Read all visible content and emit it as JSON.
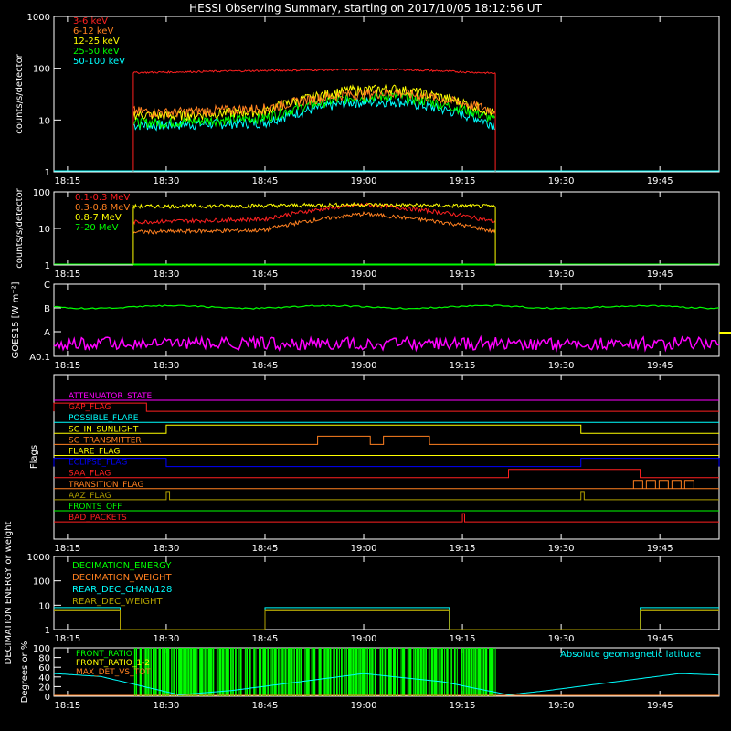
{
  "title": "HESSI Observing Summary, starting on 2017/10/05 18:12:56 UT",
  "time_ticks": [
    "18:15",
    "18:30",
    "18:45",
    "19:00",
    "19:15",
    "19:30",
    "19:45"
  ],
  "colors": {
    "background": "#000000",
    "axes": "#ffffff",
    "red": "#ff2020",
    "orange": "#ff8020",
    "yellow": "#ffff00",
    "green": "#00ff00",
    "cyan": "#00ffff",
    "blue": "#0000ff",
    "magenta": "#ff00ff",
    "olive": "#b0a000"
  },
  "chart_data": [
    {
      "type": "line",
      "ylabel": "counts/s/detector",
      "yscale": "log",
      "ylim": [
        1,
        1000
      ],
      "yticks": [
        "1",
        "10",
        "100",
        "1000"
      ],
      "xlim": [
        "18:12:56",
        "19:54"
      ],
      "data_window": [
        "18:25",
        "19:20"
      ],
      "series": [
        {
          "name": "3-6 keV",
          "color": "#ff2020",
          "x": [
            "18:25",
            "18:40",
            "18:55",
            "19:05",
            "19:20"
          ],
          "values": [
            82,
            88,
            93,
            95,
            80
          ]
        },
        {
          "name": "6-12 keV",
          "color": "#ff8020",
          "x": [
            "18:25",
            "18:30",
            "18:45",
            "18:58",
            "19:05",
            "19:20"
          ],
          "values": [
            15,
            14,
            17,
            32,
            34,
            15
          ]
        },
        {
          "name": "12-25 keV",
          "color": "#ffff00",
          "x": [
            "18:25",
            "18:30",
            "18:45",
            "18:58",
            "19:05",
            "19:20"
          ],
          "values": [
            13,
            12,
            15,
            38,
            40,
            13
          ]
        },
        {
          "name": "25-50 keV",
          "color": "#00ff00",
          "x": [
            "18:25",
            "18:30",
            "18:45",
            "18:58",
            "19:05",
            "19:20"
          ],
          "values": [
            9,
            9,
            11,
            27,
            29,
            10
          ]
        },
        {
          "name": "50-100 keV",
          "color": "#00ffff",
          "x": [
            "18:25",
            "18:30",
            "18:45",
            "18:58",
            "19:05",
            "19:20"
          ],
          "values": [
            8,
            8,
            9,
            22,
            23,
            8
          ]
        }
      ]
    },
    {
      "type": "line",
      "ylabel": "counts/s/detector",
      "yscale": "log",
      "ylim": [
        1,
        100
      ],
      "yticks": [
        "1",
        "10",
        "100"
      ],
      "series": [
        {
          "name": "0.1-0.3 MeV",
          "color": "#ff2020",
          "x": [
            "18:25",
            "18:45",
            "19:00",
            "19:20"
          ],
          "values": [
            15,
            18,
            45,
            15
          ]
        },
        {
          "name": "0.3-0.8 MeV",
          "color": "#ff8020",
          "x": [
            "18:25",
            "18:45",
            "19:00",
            "19:20"
          ],
          "values": [
            8,
            9,
            25,
            8
          ]
        },
        {
          "name": "0.8-7 MeV",
          "color": "#ffff00",
          "x": [
            "18:25",
            "18:45",
            "19:00",
            "19:20"
          ],
          "values": [
            40,
            42,
            45,
            40
          ]
        },
        {
          "name": "7-20 MeV",
          "color": "#00ff00",
          "x": [
            "18:25",
            "19:20"
          ],
          "values": [
            1,
            1
          ]
        }
      ]
    },
    {
      "type": "line",
      "ylabel": "GOES15 [W m⁻²]",
      "yticks": [
        "A0.1",
        "A",
        "B",
        "C"
      ],
      "series": [
        {
          "name": "GOES long",
          "color": "#00ff00",
          "level": "B"
        },
        {
          "name": "GOES short",
          "color": "#ff00ff",
          "level": "A0.1-A"
        }
      ]
    },
    {
      "type": "table",
      "ylabel": "Flags",
      "flags": [
        {
          "name": "ATTENUATOR_STATE",
          "color": "#ff00ff",
          "high": []
        },
        {
          "name": "GAP_FLAG",
          "color": "#ff2020",
          "high": [
            [
              "18:12:56",
              "18:27"
            ]
          ]
        },
        {
          "name": "POSSIBLE_FLARE",
          "color": "#00ffff",
          "high": []
        },
        {
          "name": "SC_IN_SUNLIGHT",
          "color": "#ffff00",
          "high": [
            [
              "18:30",
              "19:33"
            ]
          ]
        },
        {
          "name": "SC_TRANSMITTER",
          "color": "#ff8020",
          "high": [
            [
              "18:53",
              "19:01"
            ],
            [
              "19:03",
              "19:10"
            ]
          ]
        },
        {
          "name": "FLARE_FLAG",
          "color": "#ffff00",
          "high": []
        },
        {
          "name": "ECLIPSE_FLAG",
          "color": "#0000ff",
          "high": [
            [
              "18:12:56",
              "18:30"
            ],
            [
              "19:33",
              "19:54"
            ]
          ]
        },
        {
          "name": "SAA_FLAG",
          "color": "#ff2020",
          "high": [
            [
              "19:22",
              "19:42"
            ]
          ]
        },
        {
          "name": "TRANSITION_FLAG",
          "color": "#ff8020",
          "high": [
            [
              "19:41",
              "19:50"
            ]
          ]
        },
        {
          "name": "AAZ_FLAG",
          "color": "#b0a000",
          "high": [
            [
              "18:30",
              "18:30:30"
            ],
            [
              "19:33",
              "19:33:30"
            ]
          ]
        },
        {
          "name": "FRONTS_OFF",
          "color": "#00ff00",
          "high": []
        },
        {
          "name": "BAD_PACKETS",
          "color": "#ff2020",
          "high": [
            [
              "19:15",
              "19:15:20"
            ]
          ]
        }
      ]
    },
    {
      "type": "line",
      "ylabel": "DECIMATION ENERGY or weight",
      "yscale": "log",
      "ylim": [
        1,
        1000
      ],
      "yticks": [
        "1",
        "10",
        "100",
        "1000"
      ],
      "series": [
        {
          "name": "DECIMATION_ENERGY",
          "color": "#00ff00",
          "x": [
            "18:12:56",
            "18:23",
            "18:23",
            "18:45",
            "18:45",
            "19:13",
            "19:13",
            "19:42",
            "19:42",
            "19:54"
          ],
          "values": [
            6,
            6,
            1,
            1,
            6,
            6,
            1,
            1,
            6,
            6
          ]
        },
        {
          "name": "DECIMATION_WEIGHT",
          "color": "#ff8020",
          "x": [
            "18:12:56",
            "18:23",
            "18:23",
            "18:45",
            "18:45",
            "19:13",
            "19:13",
            "19:42",
            "19:42",
            "19:54"
          ],
          "values": [
            6,
            6,
            1,
            1,
            6,
            6,
            1,
            1,
            6,
            6
          ]
        },
        {
          "name": "REAR_DEC_CHAN/128",
          "color": "#00ffff",
          "x": [
            "18:12:56",
            "18:23",
            "18:23",
            "18:45",
            "18:45",
            "19:13",
            "19:13",
            "19:42",
            "19:42",
            "19:54"
          ],
          "values": [
            8,
            8,
            1,
            1,
            8,
            8,
            1,
            1,
            8,
            8
          ]
        },
        {
          "name": "REAR_DEC_WEIGHT",
          "color": "#b0a000",
          "x": [
            "18:12:56",
            "18:23",
            "18:23",
            "18:45",
            "18:45",
            "19:13",
            "19:13",
            "19:42",
            "19:42",
            "19:54"
          ],
          "values": [
            6,
            6,
            1,
            1,
            6,
            6,
            1,
            1,
            6,
            6
          ]
        }
      ]
    },
    {
      "type": "line",
      "ylabel": "Degrees or %",
      "ylim": [
        0,
        100
      ],
      "yticks": [
        "0",
        "20",
        "40",
        "60",
        "80",
        "100"
      ],
      "annotation": "Absolute geomagnetic latitude",
      "series": [
        {
          "name": "FRONT_RATIO",
          "color": "#00ff00",
          "x": [
            "18:25",
            "19:20"
          ],
          "values": [
            100,
            100
          ]
        },
        {
          "name": "FRONT_RATIO_1-2",
          "color": "#ffff00",
          "x": [],
          "values": []
        },
        {
          "name": "MAX_DET_VS_TOT",
          "color": "#ff8020",
          "x": [
            "18:12:56",
            "19:54"
          ],
          "values": [
            0,
            0
          ]
        },
        {
          "name": "Absolute geomagnetic latitude",
          "color": "#00ffff",
          "x": [
            "18:12:56",
            "18:20",
            "18:32",
            "18:40",
            "19:00",
            "19:12",
            "19:22",
            "19:28",
            "19:48",
            "19:54"
          ],
          "values": [
            47,
            41,
            3,
            12,
            47,
            30,
            3,
            12,
            47,
            44
          ]
        }
      ]
    }
  ]
}
